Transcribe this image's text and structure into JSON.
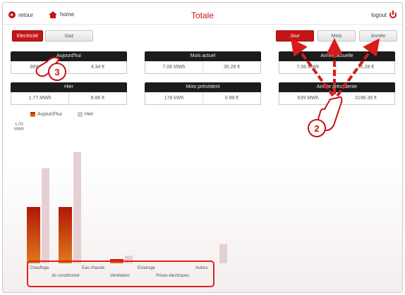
{
  "header": {
    "back_label": "retour",
    "home_label": "home",
    "title": "Totale",
    "logout_label": "logout"
  },
  "tabs": {
    "left": [
      {
        "label": "Electricité",
        "active": true
      },
      {
        "label": "Gaz",
        "active": false
      }
    ],
    "period": [
      {
        "label": "Jour",
        "active": true
      },
      {
        "label": "Mois",
        "active": false
      },
      {
        "label": "Année",
        "active": false
      }
    ]
  },
  "summary": [
    {
      "title": "Aujourd'hui",
      "energy": "869 kWh",
      "cost": "4.34 €"
    },
    {
      "title": "Mois actuel",
      "energy": "7.06 MWh",
      "cost": "35.28 €"
    },
    {
      "title": "Année actuelle",
      "energy": "7.06 MWh",
      "cost": "35.28 €"
    },
    {
      "title": "Hier",
      "energy": "1.77 MWh",
      "cost": "8.86 €"
    },
    {
      "title": "Mois précédent",
      "energy": "178 kWh",
      "cost": "0.89 €"
    },
    {
      "title": "Année précédente",
      "energy": "639 MWh",
      "cost": "3196.35 €"
    }
  ],
  "chart_data": {
    "type": "bar",
    "ylabel_value": "1.00",
    "ylabel_unit": "MWh",
    "legend": [
      {
        "name": "Aujourd'hui",
        "color": "#c9300f"
      },
      {
        "name": "Hier",
        "color": "#e1c3c8"
      }
    ],
    "categories": [
      "Chauffage",
      "Air conditionné",
      "Eau chaude",
      "Ventilation",
      "Eclairage",
      "Prises électriques",
      "Autres"
    ],
    "series": [
      {
        "name": "Aujourd'hui",
        "values": [
          0.42,
          0.42,
          0.0,
          0.03,
          0.0,
          0.0,
          0.0
        ]
      },
      {
        "name": "Hier",
        "values": [
          0.71,
          0.83,
          0.0,
          0.06,
          0.0,
          0.0,
          0.14
        ]
      }
    ],
    "ylim": [
      0,
      1.0
    ]
  },
  "annotations": {
    "badge_2": "2",
    "badge_3": "3"
  },
  "colors": {
    "accent": "#c41515",
    "highlight": "#e11f1f"
  }
}
